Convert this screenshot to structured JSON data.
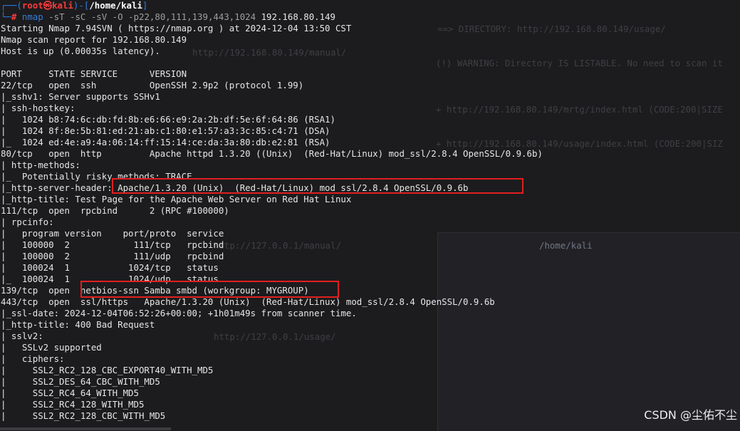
{
  "prompt": {
    "user": "root",
    "at": "㉿",
    "host": "kali",
    "path": "/home/kali",
    "symbol": "#",
    "command_name": "nmap",
    "command_args": " -sT -sC -sV -O -p22,80,111,139,443,1024",
    "command_target": " 192.168.80.149"
  },
  "output_lines": [
    "Starting Nmap 7.94SVN ( https://nmap.org ) at 2024-12-04 13:50 CST",
    "Nmap scan report for 192.168.80.149",
    "Host is up (0.00035s latency).",
    "",
    "PORT     STATE SERVICE      VERSION",
    "22/tcp   open  ssh          OpenSSH 2.9p2 (protocol 1.99)",
    "|_sshv1: Server supports SSHv1",
    "| ssh-hostkey: ",
    "|   1024 b8:74:6c:db:fd:8b:e6:66:e9:2a:2b:df:5e:6f:64:86 (RSA1)",
    "|   1024 8f:8e:5b:81:ed:21:ab:c1:80:e1:57:a3:3c:85:c4:71 (DSA)",
    "|_  1024 ed:4e:a9:4a:06:14:ff:15:14:ce:da:3a:80:db:e2:81 (RSA)",
    "80/tcp   open  http         Apache httpd 1.3.20 ((Unix)  (Red-Hat/Linux) mod_ssl/2.8.4 OpenSSL/0.9.6b)",
    "| http-methods: ",
    "|_  Potentially risky methods: TRACE",
    "|_http-server-header: Apache/1.3.20 (Unix)  (Red-Hat/Linux) mod_ssl/2.8.4 OpenSSL/0.9.6b",
    "|_http-title: Test Page for the Apache Web Server on Red Hat Linux",
    "111/tcp  open  rpcbind      2 (RPC #100000)",
    "| rpcinfo: ",
    "|   program version    port/proto  service",
    "|   100000  2            111/tcp   rpcbind",
    "|   100000  2            111/udp   rpcbind",
    "|   100024  1           1024/tcp   status",
    "|_  100024  1           1024/udp   status",
    "139/tcp  open  netbios-ssn Samba smbd (workgroup: MYGROUP)",
    "443/tcp  open  ssl/https   Apache/1.3.20 (Unix)  (Red-Hat/Linux) mod_ssl/2.8.4 OpenSSL/0.9.6b",
    "|_ssl-date: 2024-12-04T06:52:26+00:00; +1h01m49s from scanner time.",
    "|_http-title: 400 Bad Request",
    "| sslv2: ",
    "|   SSLv2 supported",
    "|   ciphers: ",
    "|     SSL2_RC2_128_CBC_EXPORT40_WITH_MD5",
    "|     SSL2_DES_64_CBC_WITH_MD5",
    "|     SSL2_RC4_64_WITH_MD5",
    "|     SSL2_RC4_128_WITH_MD5",
    "|     SSL2_RC2_128_CBC_WITH_MD5"
  ],
  "background_text": {
    "directory": "==> DIRECTORY: http://192.168.80.149/usage/",
    "manual": "http://192.168.80.149/manual/",
    "warning": "(!) WARNING: Directory IS LISTABLE. No need to scan it",
    "mrtg_index": "+ http://192.168.80.149/mrtg/index.html (CODE:200|SIZE",
    "usage_index": "+ http://192.168.80.149/usage/index.html (CODE:200|SIZ",
    "right_pane_path": "/home/kali",
    "localhost_manual": "http://127.0.0.1/manual/",
    "localhost_usage": "http://127.0.0.1/usage/"
  },
  "watermark": "CSDN @尘佑不尘",
  "colors": {
    "background": "#1c1c1e",
    "text": "#e6e6e6",
    "prompt_blue": "#2e7de6",
    "root_red": "#ff3b3b",
    "highlight_box": "#e21f1f"
  }
}
